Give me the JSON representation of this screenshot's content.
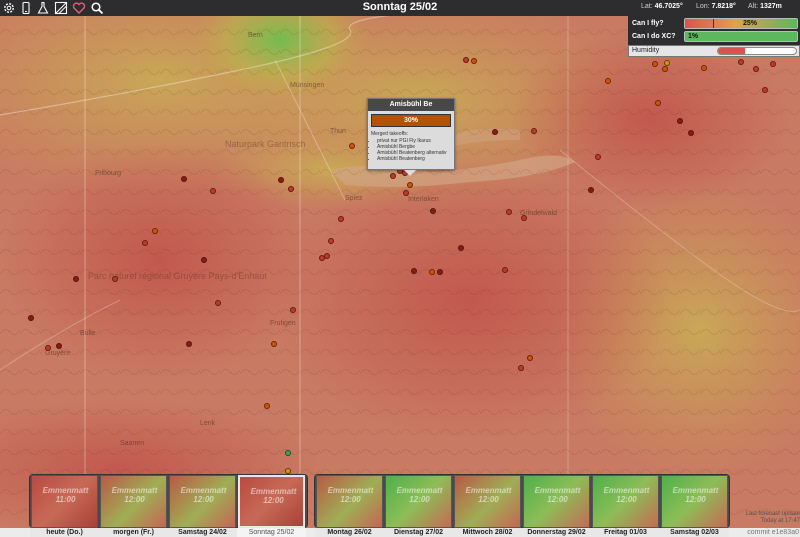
{
  "toolbar": {
    "icons": [
      "gear-icon",
      "phone-icon",
      "flask-icon",
      "image-icon",
      "heart-icon",
      "search-icon"
    ]
  },
  "title": "Sonntag 25/02",
  "coords": {
    "lat_label": "Lat:",
    "lat": "46.7025°",
    "lon_label": "Lon:",
    "lon": "7.8218°",
    "alt_label": "Alt:",
    "alt": "1327m"
  },
  "panel": {
    "fly": {
      "label": "Can I fly?",
      "value": "25%",
      "fraction": 0.25
    },
    "xc": {
      "label": "Can I do XC?",
      "value": "1%",
      "fraction": 0.01
    },
    "humidity": {
      "label": "Humidity",
      "fraction": 0.35
    },
    "colors": {
      "bad": "#d9534f",
      "good": "#5cb85c",
      "marker": "#7a1c1c"
    }
  },
  "map": {
    "labels": [
      "Bern",
      "Münsingen",
      "Thun",
      "Fribourg",
      "Bulle",
      "Gruyère",
      "Spiez",
      "Frutigen",
      "Grindelwald",
      "Interlaken",
      "Lenk",
      "Saanen"
    ],
    "regions": [
      "Parc naturel régional Gruyère Pays-d'Enhaut",
      "Naturpark Gantrisch"
    ],
    "spot_colors": {
      "red": "#c0392b",
      "orange": "#d35400",
      "darkred": "#8e1b12",
      "green": "#27ae60",
      "yellow": "#c7a000"
    }
  },
  "popup": {
    "title": "Amisbühl Be",
    "value": "30%",
    "merged_label": "Merged takeoffs:",
    "items": [
      "privat nur PGI Fly Ikarus",
      "Amisbühl Bergbe",
      "Amisbühl Beatenberg alternativ",
      "Amisbühl Beatenberg"
    ]
  },
  "days": [
    {
      "label": "heute (Do.)",
      "thumb": "Emmenmatt 11:00",
      "selected": false,
      "tint": "red"
    },
    {
      "label": "morgen (Fr.)",
      "thumb": "Emmenmatt 12:00",
      "selected": false,
      "tint": "mixed"
    },
    {
      "label": "Samstag 24/02",
      "thumb": "Emmenmatt 12:00",
      "selected": false,
      "tint": "mixed"
    },
    {
      "label": "Sonntag 25/02",
      "thumb": "Emmenmatt 12:00",
      "selected": true,
      "tint": "red"
    },
    {
      "label": "Montag 26/02",
      "thumb": "Emmenmatt 12:00",
      "selected": false,
      "tint": "mixed"
    },
    {
      "label": "Dienstag 27/02",
      "thumb": "Emmenmatt 12:00",
      "selected": false,
      "tint": "green"
    },
    {
      "label": "Mittwoch 28/02",
      "thumb": "Emmenmatt 12:00",
      "selected": false,
      "tint": "mixed"
    },
    {
      "label": "Donnerstag 29/02",
      "thumb": "Emmenmatt 12:00",
      "selected": false,
      "tint": "green"
    },
    {
      "label": "Freitag 01/03",
      "thumb": "Emmenmatt 12:00",
      "selected": false,
      "tint": "green"
    },
    {
      "label": "Samstag 02/03",
      "thumb": "Emmenmatt 12:00",
      "selected": false,
      "tint": "green"
    }
  ],
  "footer": {
    "last_update_1": "Last forecast update",
    "last_update_2": "Today at 17:47",
    "commit": "commit e1e83a0"
  }
}
